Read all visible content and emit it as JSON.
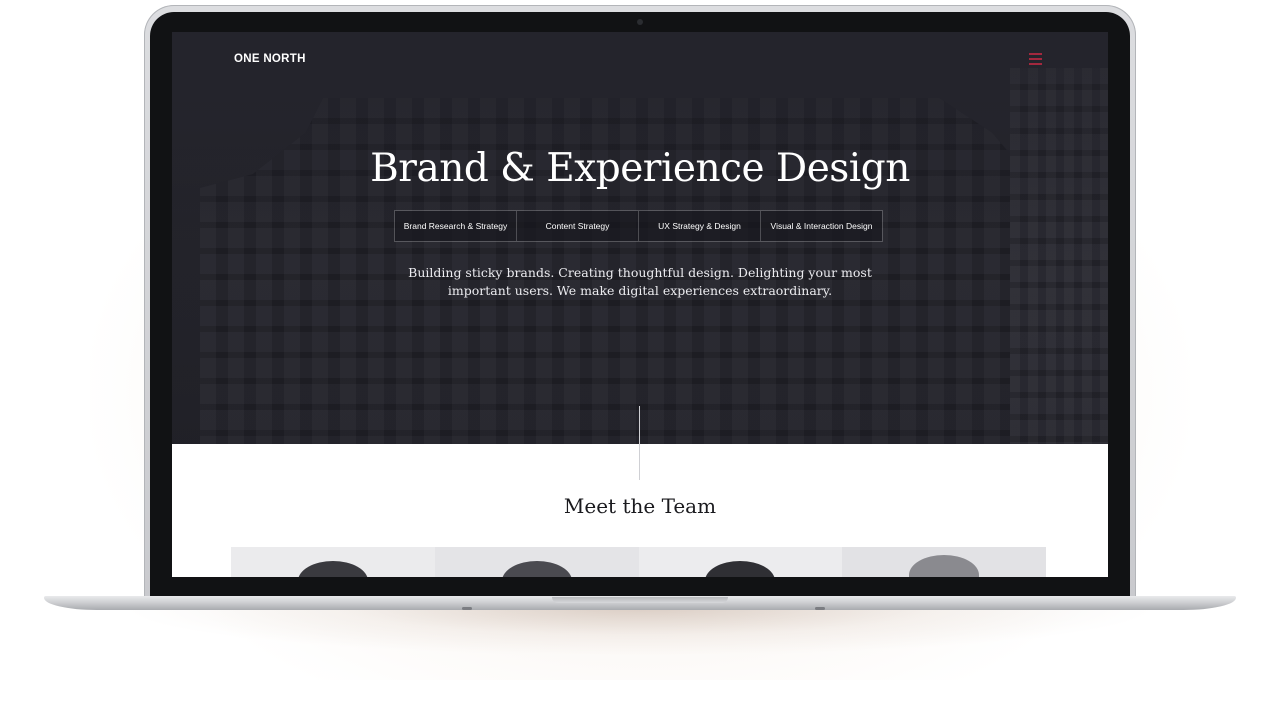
{
  "site": {
    "logo": "ONE NORTH",
    "menu_icon": "hamburger-menu-icon",
    "menu_color": "#a3283e"
  },
  "hero": {
    "title": "Brand & Experience Design",
    "tabs": [
      {
        "label": "Brand Research & Strategy"
      },
      {
        "label": "Content Strategy"
      },
      {
        "label": "UX Strategy & Design"
      },
      {
        "label": "Visual & Interaction Design"
      }
    ],
    "description": "Building sticky brands. Creating thoughtful design. Delighting your most important users. We make digital experiences extraordinary."
  },
  "team": {
    "title": "Meet the Team",
    "members": [
      {
        "photo": "team-member-photo-1"
      },
      {
        "photo": "team-member-photo-2"
      },
      {
        "photo": "team-member-photo-3"
      },
      {
        "photo": "team-member-photo-4"
      }
    ]
  },
  "colors": {
    "hero_background": "#26262d",
    "accent": "#a3283e",
    "text_light": "#ffffff"
  }
}
